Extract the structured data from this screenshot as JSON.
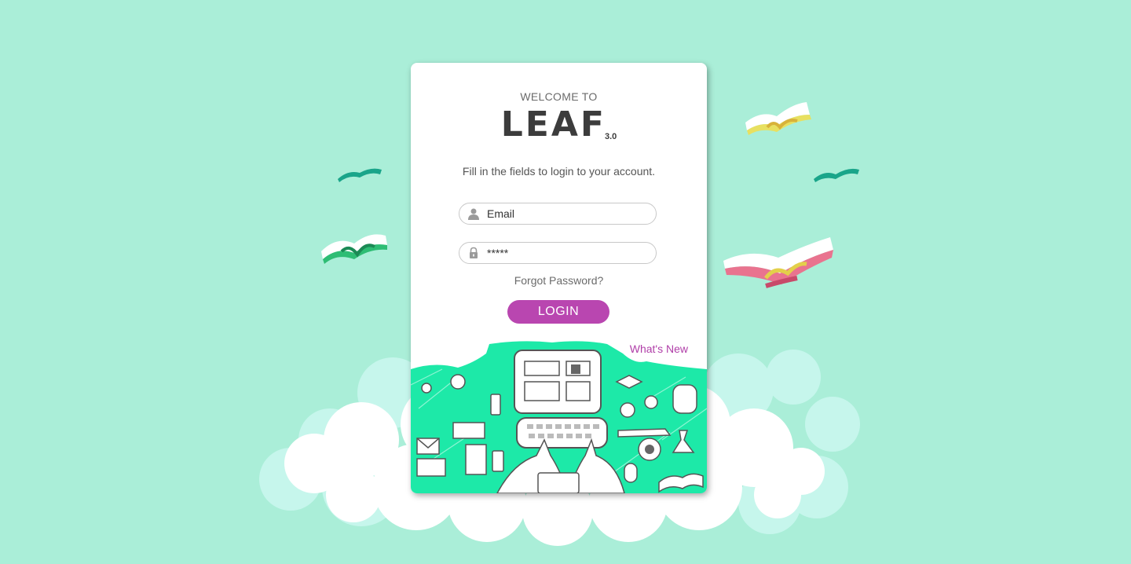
{
  "login": {
    "welcome": "WELCOME TO",
    "logo_text": "LEAF",
    "logo_version": "3.0",
    "subtitle": "Fill in the fields to login to your account.",
    "email_placeholder": "Email",
    "password_value": "*****",
    "forgot_password": "Forgot Password?",
    "login_button": "LOGIN",
    "whats_new": "What's New"
  },
  "icons": {
    "email": "user-icon",
    "password": "lock-icon"
  },
  "colors": {
    "background": "#aaeed8",
    "accent": "#b946b0",
    "illustration": "#1de9a8"
  }
}
